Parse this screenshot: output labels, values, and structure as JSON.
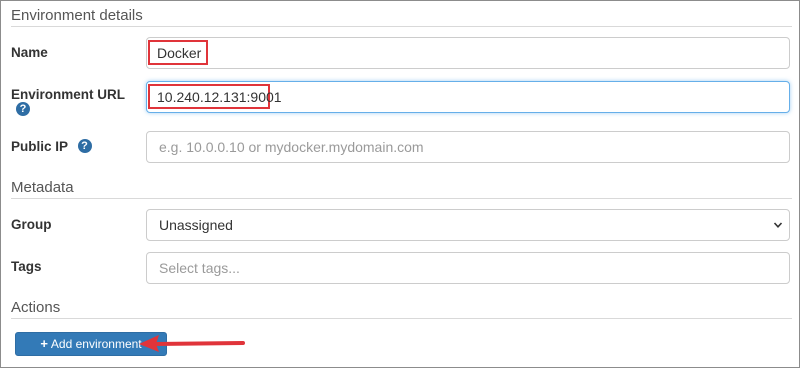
{
  "sections": {
    "environment_details": "Environment details",
    "metadata": "Metadata",
    "actions": "Actions"
  },
  "fields": {
    "name": {
      "label": "Name",
      "value": "Docker"
    },
    "environment_url": {
      "label": "Environment URL",
      "value": "10.240.12.131:9001"
    },
    "public_ip": {
      "label": "Public IP",
      "placeholder": "e.g. 10.0.0.10 or mydocker.mydomain.com"
    },
    "group": {
      "label": "Group",
      "value": "Unassigned"
    },
    "tags": {
      "label": "Tags",
      "placeholder": "Select tags..."
    }
  },
  "help_icon_glyph": "?",
  "buttons": {
    "add_environment": {
      "icon": "+",
      "label": "Add environment"
    }
  },
  "colors": {
    "primary": "#337ab7",
    "highlight": "#e0343a",
    "help_icon": "#2e6da4"
  }
}
